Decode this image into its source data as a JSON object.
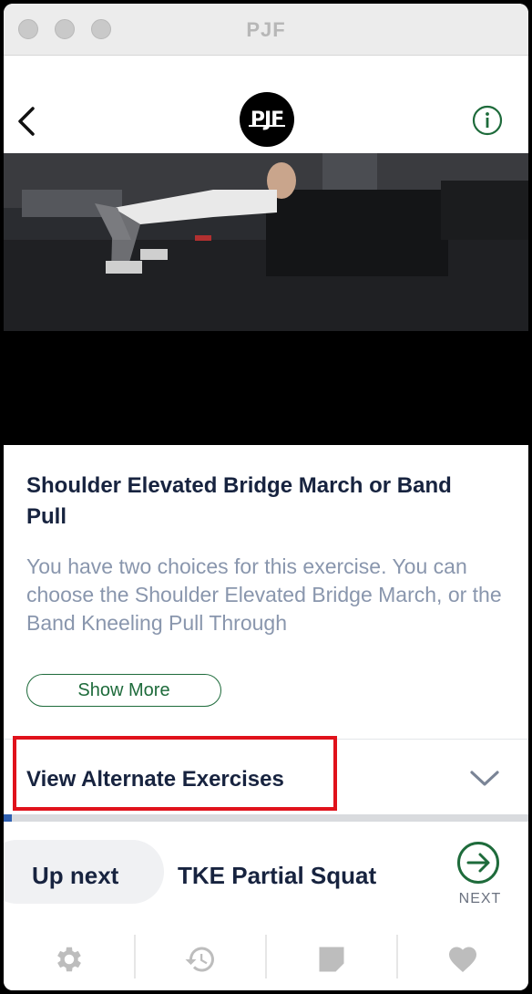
{
  "window": {
    "title": "PJF"
  },
  "header": {
    "back_icon": "chevron-left-icon",
    "logo_text": "PJF",
    "info_icon": "info-circle-icon"
  },
  "exercise": {
    "title": "Shoulder Elevated Bridge March or Band Pull",
    "description": "You have two choices for this exercise. You can choose the Shoulder Elevated Bridge March, or the Band Kneeling Pull Through",
    "show_more_label": "Show More"
  },
  "alternates": {
    "label": "View Alternate Exercises",
    "chevron_icon": "chevron-down-icon"
  },
  "progress": {
    "fraction": 0.015
  },
  "up_next": {
    "label": "Up next",
    "exercise_name": "TKE Partial Squat",
    "next_label": "NEXT",
    "next_icon": "arrow-right-circle-icon"
  },
  "tabbar": {
    "items": [
      {
        "icon": "gear-icon"
      },
      {
        "icon": "history-icon"
      },
      {
        "icon": "note-icon"
      },
      {
        "icon": "heart-icon"
      }
    ]
  },
  "colors": {
    "accent_green": "#1e6b3b",
    "title_navy": "#17233f",
    "desc_gray": "#8996ad",
    "progress_blue": "#2e5fb0",
    "highlight_red": "#e0121b"
  }
}
